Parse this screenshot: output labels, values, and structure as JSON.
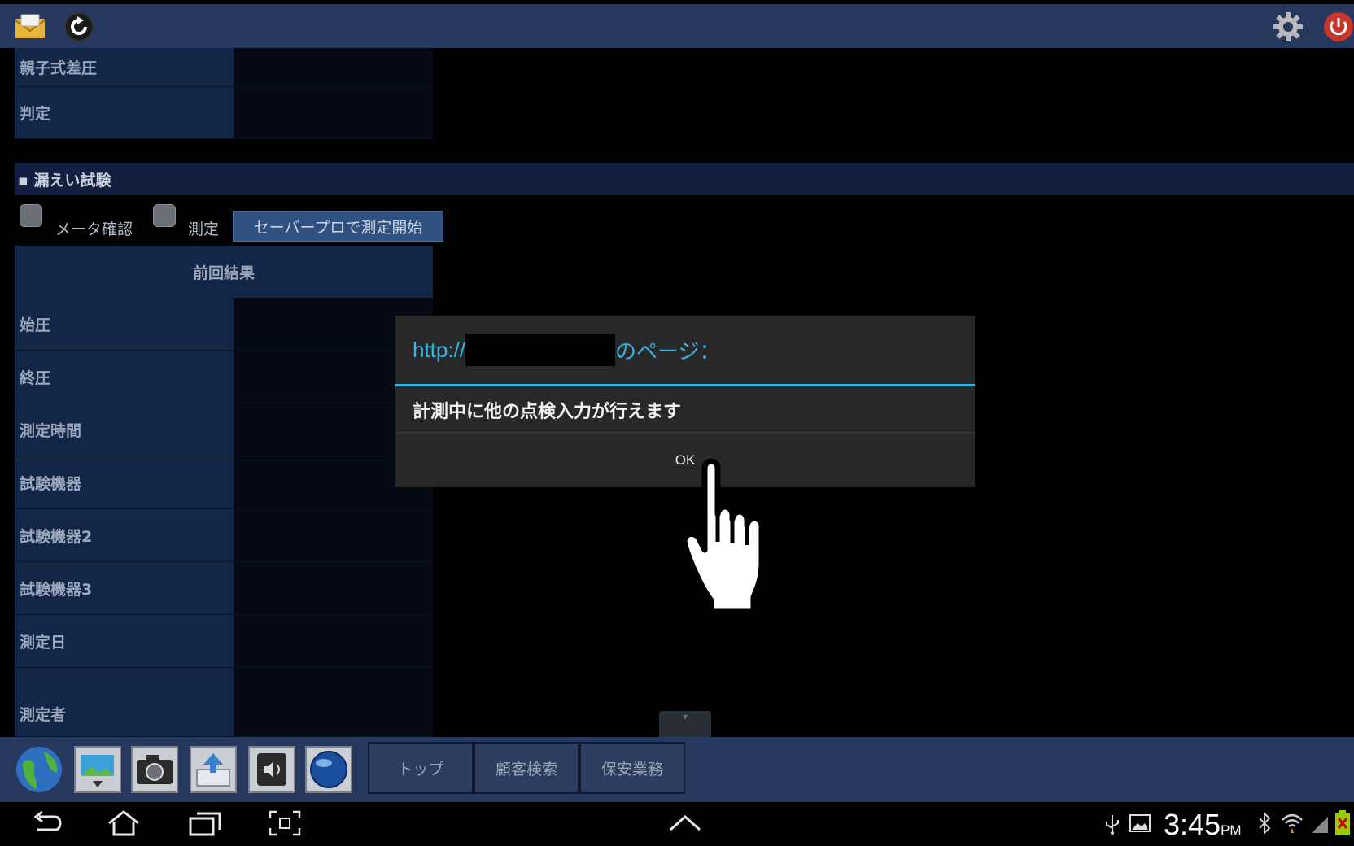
{
  "topbar": {
    "icons": [
      "mail-icon",
      "refresh-icon",
      "gear-icon",
      "power-icon"
    ]
  },
  "upper_rows": [
    {
      "label": "親子式差圧"
    },
    {
      "label": "判定"
    }
  ],
  "leak_section": {
    "title": "▪ 漏えい試験",
    "meter_check_label": "メータ確認",
    "measure_label": "測定",
    "start_button": "セーバープロで測定開始",
    "prev_results_header": "前回結果",
    "rows": [
      {
        "label": "始圧"
      },
      {
        "label": "終圧"
      },
      {
        "label": "測定時間"
      },
      {
        "label": "試験機器"
      },
      {
        "label": "試験機器2"
      },
      {
        "label": "試験機器3"
      },
      {
        "label": "測定日"
      },
      {
        "label": "測定者"
      }
    ]
  },
  "dialog": {
    "title_prefix": "http://",
    "title_suffix": "のページ：",
    "message": "計測中に他の点検入力が行えます",
    "ok_label": "OK"
  },
  "toolbar": {
    "tools": [
      "globe-icon",
      "slides-icon",
      "camera-icon",
      "upload-icon",
      "volume-icon",
      "world-icon"
    ],
    "tabs": [
      "トップ",
      "顧客検索",
      "保安業務"
    ]
  },
  "status": {
    "time": "3:45",
    "ampm": "PM"
  },
  "colors": {
    "app_bar": "#26385e",
    "dialog_accent": "#33b5e5"
  }
}
